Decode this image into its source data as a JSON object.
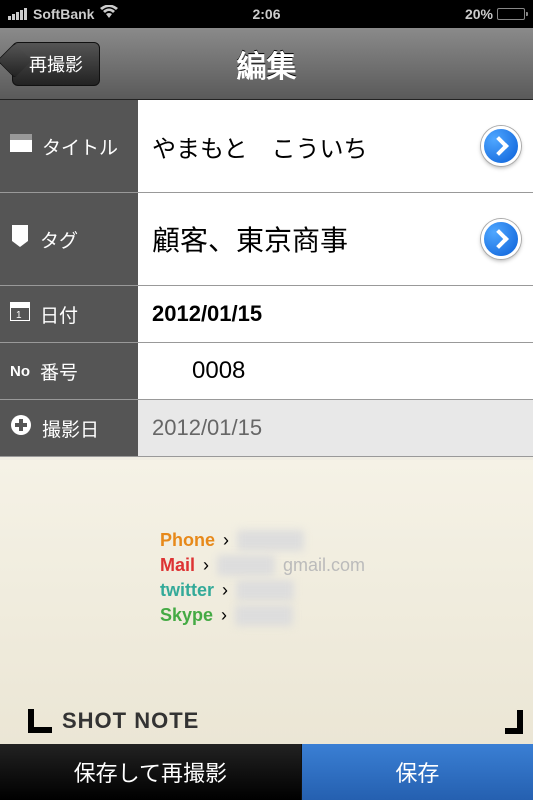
{
  "status": {
    "carrier": "SoftBank",
    "time": "2:06",
    "battery_pct": "20%"
  },
  "nav": {
    "back_label": "再撮影",
    "title": "編集"
  },
  "fields": {
    "title": {
      "label": "タイトル",
      "value": "やまもと　こういち"
    },
    "tag": {
      "label": "タグ",
      "value": "顧客、東京商事"
    },
    "date": {
      "label": "日付",
      "value": "2012/01/15"
    },
    "number": {
      "label": "番号",
      "value": "0008"
    },
    "shot": {
      "label": "撮影日",
      "value": "2012/01/15"
    }
  },
  "card": {
    "phone_label": "Phone",
    "mail_label": "Mail",
    "mail_domain": "gmail.com",
    "twitter_label": "twitter",
    "skype_label": "Skype",
    "brand": "SHOT NOTE"
  },
  "bottom": {
    "save_reshoot": "保存して再撮影",
    "save": "保存"
  }
}
